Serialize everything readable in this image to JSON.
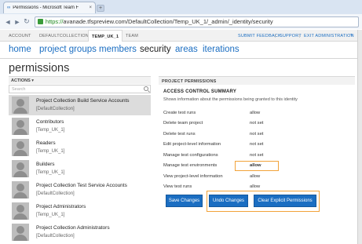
{
  "browser": {
    "tab_title": "Permissions - Microsoft Team F",
    "tab_close": "×",
    "new_tab": "+",
    "back": "◄",
    "forward": "►",
    "reload": "↻",
    "url_scheme": "https://",
    "url_rest": "avanade.tfspreview.com/DefaultCollection/Temp_UK_1/_admin/_identity/security"
  },
  "topbar": {
    "account": "ACCOUNT",
    "collection": "DEFAULTCOLLECTION",
    "project": "TEMP_UK_1",
    "team": "TEAM",
    "submit_feedback": "SUBMIT FEEDBACK",
    "support": "SUPPORT",
    "exit_admin": "EXIT ADMINISTRATION",
    "sep1": "|",
    "sep2": "|",
    "help": "?"
  },
  "nav": {
    "home": "home",
    "project_groups": "project groups",
    "members": "members",
    "security": "security",
    "areas": "areas",
    "iterations": "iterations"
  },
  "page_title": "permissions",
  "left": {
    "actions_label": "ACTIONS ▾",
    "search_placeholder": "Search",
    "groups": [
      {
        "name": "Project Collection Build Service Accounts",
        "sub": "[DefaultCollection]"
      },
      {
        "name": "Contributors",
        "sub": "[Temp_UK_1]"
      },
      {
        "name": "Readers",
        "sub": "[Temp_UK_1]"
      },
      {
        "name": "Builders",
        "sub": "[Temp_UK_1]"
      },
      {
        "name": "Project Collection Test Service Accounts",
        "sub": "[DefaultCollection]"
      },
      {
        "name": "Project Administrators",
        "sub": "[Temp_UK_1]"
      },
      {
        "name": "Project Collection Administrators",
        "sub": "[DefaultCollection]"
      }
    ]
  },
  "right": {
    "header": "PROJECT PERMISSIONS",
    "summary_title": "ACCESS CONTROL SUMMARY",
    "summary_desc": "Shows information about the permissions being granted to this identity",
    "permissions": [
      {
        "name": "Create test runs",
        "value": "allow"
      },
      {
        "name": "Delete team project",
        "value": "not set"
      },
      {
        "name": "Delete test runs",
        "value": "not set"
      },
      {
        "name": "Edit project-level information",
        "value": "not set"
      },
      {
        "name": "Manage test configurations",
        "value": "not set"
      },
      {
        "name": "Manage test environments",
        "value": "allow"
      },
      {
        "name": "View project-level information",
        "value": "allow"
      },
      {
        "name": "View test runs",
        "value": "allow"
      }
    ],
    "buttons": {
      "save": "Save Changes",
      "undo": "Undo Changes",
      "clear": "Clear Explicit Permissions"
    }
  },
  "colors": {
    "accent": "#1b6ec2",
    "highlight": "#f2a33a"
  }
}
